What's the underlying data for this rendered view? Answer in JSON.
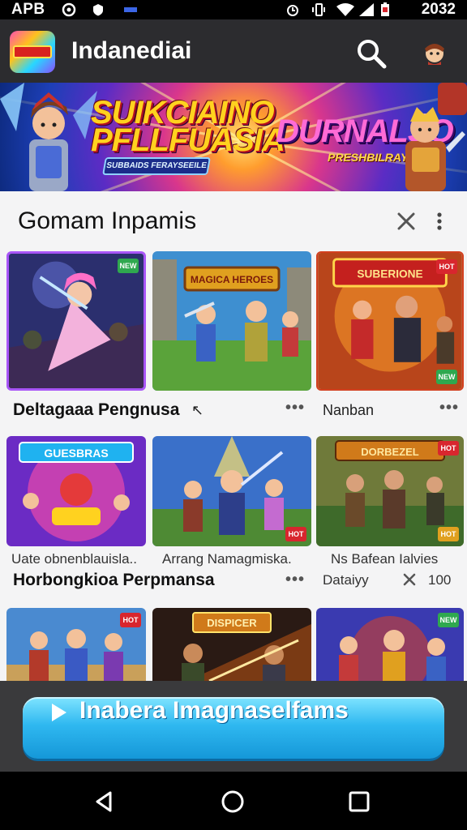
{
  "status_bar": {
    "left_text": "APB",
    "time": "2032"
  },
  "app_bar": {
    "title": "Indanediai",
    "logo_text": ""
  },
  "banner": {
    "title_line1": "SUIKCIAINO",
    "title_line2": "PFLLFUASIA",
    "ribbon": "SUBBAIDS FERAYSEEILE",
    "title_right": "DURNALSO",
    "subtitle_right": "PRESHBILRAY"
  },
  "section": {
    "title": "Gomam Inpamis",
    "row1": {
      "label_left": "Deltagaaa  Pengnusa",
      "label_left_suffix": "↖",
      "label_right": "Nanban"
    },
    "row2": {
      "caption_1": "Uate obnenblauisla..",
      "caption_2": "Arrang Namagmiska.",
      "caption_3": "Ns Bafean Ialvies",
      "label_left": "Horbongkioa  Perpmansa",
      "label_right": "Dataiyy",
      "count": "100"
    }
  },
  "tiles": [
    {
      "title_art": "",
      "badge": "NEW",
      "badge_color": "#2fa84f"
    },
    {
      "title_art": "MAGICA HEROES",
      "badge": "",
      "badge_color": ""
    },
    {
      "title_art": "SUBERIONE",
      "badge": "HOT",
      "badge_color": "#d8262e"
    },
    {
      "title_art": "GUESBRAS",
      "badge": "",
      "badge_color": ""
    },
    {
      "title_art": "",
      "badge": "HOT",
      "badge_color": "#d8262e"
    },
    {
      "title_art": "DORBEZEL",
      "badge": "HOT",
      "badge_color": "#d8262e"
    },
    {
      "title_art": "",
      "badge": "HOT",
      "badge_color": "#d8262e"
    },
    {
      "title_art": "DISPICER",
      "badge": "",
      "badge_color": ""
    },
    {
      "title_art": "",
      "badge": "NEW",
      "badge_color": "#2fa84f"
    }
  ],
  "cta": {
    "label": "Inabera Imagnaselfams",
    "icon": "play-icon"
  },
  "colors": {
    "accent": "#2fb8f0",
    "appbar": "#2c2c2f",
    "panel": "#f4f4f5"
  }
}
